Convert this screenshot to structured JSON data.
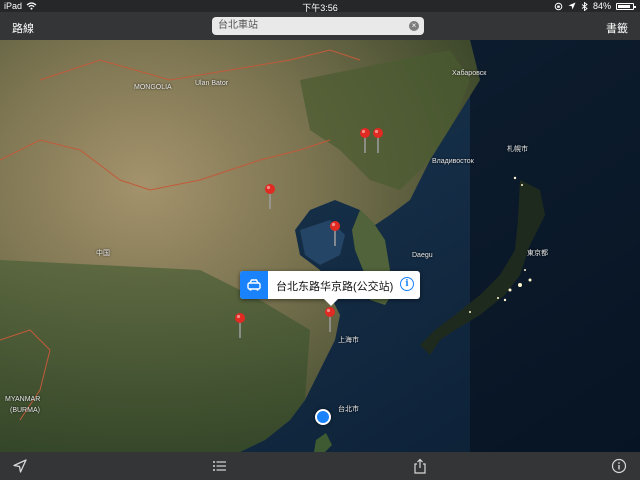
{
  "status_bar": {
    "device": "iPad",
    "time": "下午3:56",
    "battery": "84%",
    "battery_level": 0.84
  },
  "nav_bar": {
    "left_button": "路線",
    "right_button": "書籤",
    "search_value": "台北車站"
  },
  "map": {
    "labels": {
      "mongolia": "MONGOLIA",
      "ulan_bator": "Ulan Bator",
      "khabarovsk": "Хабаровск",
      "vladivostok": "Владивосток",
      "sapporo": "札幌市",
      "daegu": "Daegu",
      "tokyo": "東京都",
      "shanghai": "上海市",
      "myanmar": "MYANMAR",
      "burma": "(BURMA)",
      "taipei": "台北市",
      "china": "中国"
    },
    "callout": {
      "title": "台北东路华京路(公交站)"
    }
  },
  "toolbar": {
    "icons": [
      "location-arrow-icon",
      "list-icon",
      "share-icon",
      "info-icon"
    ]
  },
  "colors": {
    "accent": "#1a82fb",
    "pin": "#e02a22",
    "bar": "#373737"
  }
}
